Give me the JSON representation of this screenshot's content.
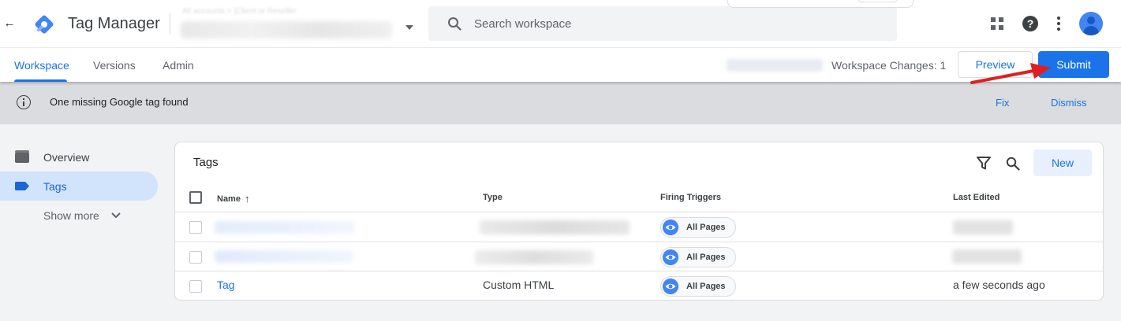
{
  "header": {
    "back_icon": "arrow-back-icon",
    "app_title": "Tag Manager",
    "account_breadcrumb": "All accounts > [Client or Reseller",
    "search_placeholder": "Search workspace",
    "icons": [
      "apps-icon",
      "help-icon",
      "more-vert-icon",
      "account-avatar"
    ]
  },
  "subnav": {
    "tabs": [
      {
        "label": "Workspace",
        "active": true
      },
      {
        "label": "Versions",
        "active": false
      },
      {
        "label": "Admin",
        "active": false
      }
    ],
    "workspace_changes": "Workspace Changes: 1",
    "preview_label": "Preview",
    "submit_label": "Submit"
  },
  "banner": {
    "message": "One missing Google tag found",
    "fix_label": "Fix",
    "dismiss_label": "Dismiss"
  },
  "sidebar": {
    "items": [
      {
        "label": "Overview",
        "icon": "overview-icon",
        "active": false
      },
      {
        "label": "Tags",
        "icon": "tag-icon",
        "active": true
      }
    ],
    "show_more_label": "Show more"
  },
  "tags_table": {
    "title": "Tags",
    "new_label": "New",
    "columns": [
      "Name",
      "Type",
      "Firing Triggers",
      "Last Edited"
    ],
    "sort_column": "Name",
    "sort_direction": "ascending",
    "rows": [
      {
        "name": "",
        "type": "",
        "trigger": "All Pages",
        "last_edited": ""
      },
      {
        "name": "",
        "type": "",
        "trigger": "All Pages",
        "last_edited": ""
      },
      {
        "name": "Tag",
        "type": "Custom HTML",
        "trigger": "All Pages",
        "last_edited": "a few seconds ago"
      }
    ]
  },
  "colors": {
    "accent_blue": "#1a73e8",
    "annotation_red": "#e02020",
    "banner_bg": "#dadce0",
    "active_nav_bg": "#d2e3fc"
  }
}
